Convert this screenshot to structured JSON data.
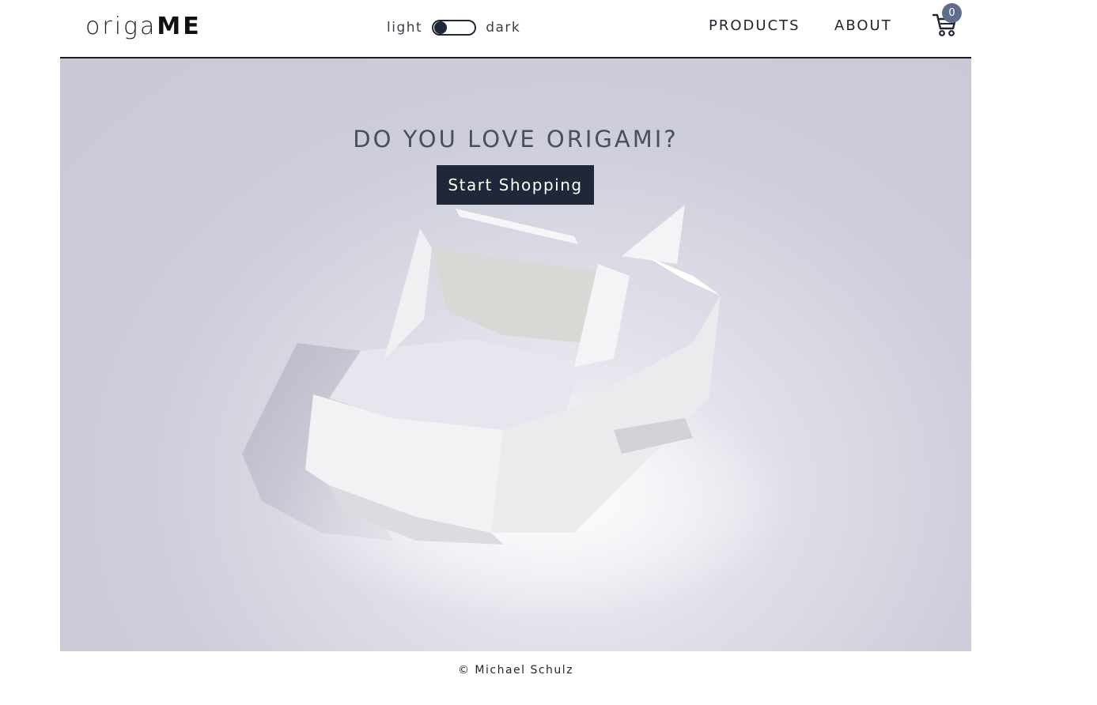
{
  "header": {
    "logo_light": "origa",
    "logo_bold": "ME",
    "theme_light_label": "light",
    "theme_dark_label": "dark",
    "theme_mode": "light",
    "nav": {
      "products": "PRODUCTS",
      "about": "ABOUT"
    },
    "cart_icon": "cart-icon",
    "cart_count": "0"
  },
  "hero": {
    "title": "DO YOU LOVE ORIGAMI?",
    "cta_label": "Start Shopping",
    "image_subject": "paper-origami-car"
  },
  "footer": {
    "copyright": "© Michael Schulz"
  },
  "colors": {
    "dark": "#1f2838",
    "badge": "#5d6d8a",
    "hero_bg": "#c9c9d6"
  }
}
